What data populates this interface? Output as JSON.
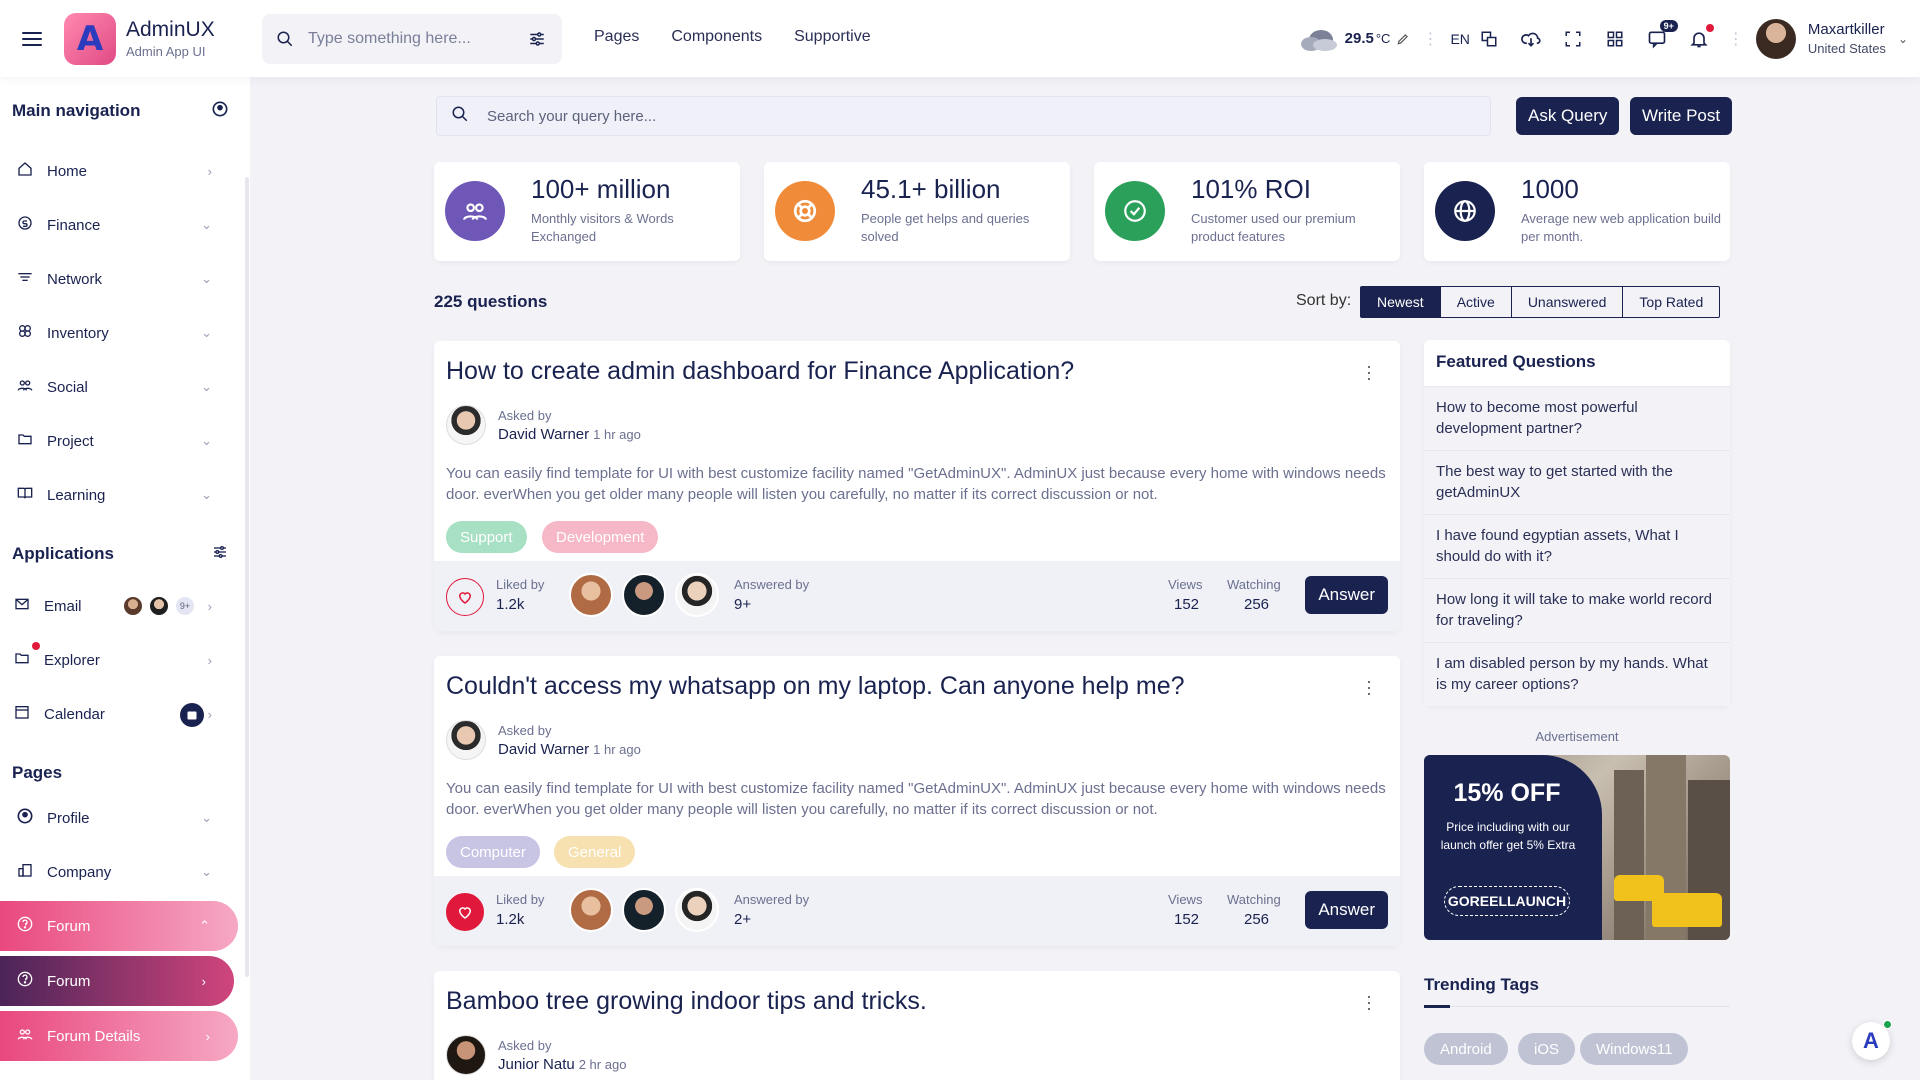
{
  "header": {
    "app_name": "AdminUX",
    "app_sub": "Admin App UI",
    "logo_letter": "A",
    "search_placeholder": "Type something here...",
    "nav": [
      "Pages",
      "Components",
      "Supportive"
    ],
    "temperature": "29.5",
    "temp_unit": "°C",
    "language": "EN",
    "message_badge": "9+",
    "user_name": "Maxartkiller",
    "user_country": "United States"
  },
  "sidebar": {
    "main_title": "Main navigation",
    "main_items": [
      {
        "label": "Home",
        "icon": "home-icon"
      },
      {
        "label": "Finance",
        "icon": "finance-icon"
      },
      {
        "label": "Network",
        "icon": "network-icon"
      },
      {
        "label": "Inventory",
        "icon": "inventory-icon"
      },
      {
        "label": "Social",
        "icon": "social-icon"
      },
      {
        "label": "Project",
        "icon": "folder-icon"
      },
      {
        "label": "Learning",
        "icon": "book-icon"
      }
    ],
    "apps_title": "Applications",
    "app_items": [
      {
        "label": "Email",
        "icon": "mail-icon",
        "badge": "9+"
      },
      {
        "label": "Explorer",
        "icon": "folder-icon"
      },
      {
        "label": "Calendar",
        "icon": "calendar-icon"
      }
    ],
    "pages_title": "Pages",
    "page_items": [
      {
        "label": "Profile",
        "icon": "user-icon"
      },
      {
        "label": "Company",
        "icon": "company-icon"
      },
      {
        "label": "Forum",
        "icon": "help-icon"
      },
      {
        "label": "Forum",
        "icon": "help-icon"
      },
      {
        "label": "Forum Details",
        "icon": "users-icon"
      }
    ]
  },
  "main": {
    "search_placeholder": "Search your query here...",
    "ask_query": "Ask Query",
    "write_post": "Write Post",
    "stats": [
      {
        "value": "100+ million",
        "desc": "Monthly visitors & Words Exchanged",
        "color": "#6f57b8"
      },
      {
        "value": "45.1+ billion",
        "desc": "People get helps and queries solved",
        "color": "#f08b3a"
      },
      {
        "value": "101% ROI",
        "desc": "Customer used our premium product features",
        "color": "#2aa05a"
      },
      {
        "value": "1000",
        "desc": "Average new web application build per month.",
        "color": "#1a2250"
      }
    ],
    "question_count": "225 questions",
    "sort_label": "Sort by:",
    "sort_options": [
      "Newest",
      "Active",
      "Unanswered",
      "Top Rated"
    ],
    "questions": [
      {
        "title": "How to create admin dashboard for Finance Application?",
        "asked_by_label": "Asked by",
        "author": "David Warner",
        "ago": "1 hr ago",
        "body": "You can easily find template for UI with best customize facility named \"GetAdminUX\". AdminUX just because every home with windows needs door. everWhen you get older many people will listen you carefully, no matter if its correct discussion or not.",
        "tags": [
          {
            "label": "Support",
            "color": "#a7e0c3"
          },
          {
            "label": "Development",
            "color": "#f6b7c6"
          }
        ],
        "liked_by_label": "Liked by",
        "likes": "1.2k",
        "answered_by_label": "Answered by",
        "answered": "9+",
        "views_label": "Views",
        "views": "152",
        "watching_label": "Watching",
        "watching": "256",
        "answer_label": "Answer",
        "liked": false
      },
      {
        "title": "Couldn't access my whatsapp on my laptop. Can anyone help me?",
        "asked_by_label": "Asked by",
        "author": "David Warner",
        "ago": "1 hr ago",
        "body": "You can easily find template for UI with best customize facility named \"GetAdminUX\". AdminUX just because every home with windows needs door. everWhen you get older many people will listen you carefully, no matter if its correct discussion or not.",
        "tags": [
          {
            "label": "Computer",
            "color": "#c8c4e4"
          },
          {
            "label": "General",
            "color": "#f7e1b0"
          }
        ],
        "liked_by_label": "Liked by",
        "likes": "1.2k",
        "answered_by_label": "Answered by",
        "answered": "2+",
        "views_label": "Views",
        "views": "152",
        "watching_label": "Watching",
        "watching": "256",
        "answer_label": "Answer",
        "liked": true
      },
      {
        "title": "Bamboo tree growing indoor tips and tricks.",
        "asked_by_label": "Asked by",
        "author": "Junior Natu",
        "ago": "2 hr ago"
      }
    ]
  },
  "right": {
    "featured_title": "Featured Questions",
    "featured": [
      "How to become most powerful development partner?",
      "The best way to get started with the getAdminUX",
      "I have found egyptian assets, What I should do with it?",
      "How long it will take to make world record for traveling?",
      "I am disabled person by my hands. What is my career options?"
    ],
    "ad_label": "Advertisement",
    "ad_offer": "15% OFF",
    "ad_desc": "Price including with our launch offer get 5% Extra",
    "ad_code": "GOREELLAUNCH",
    "trending_title": "Trending Tags",
    "trending_tags": [
      "Android",
      "iOS",
      "Windows11"
    ]
  },
  "fab_letter": "A"
}
